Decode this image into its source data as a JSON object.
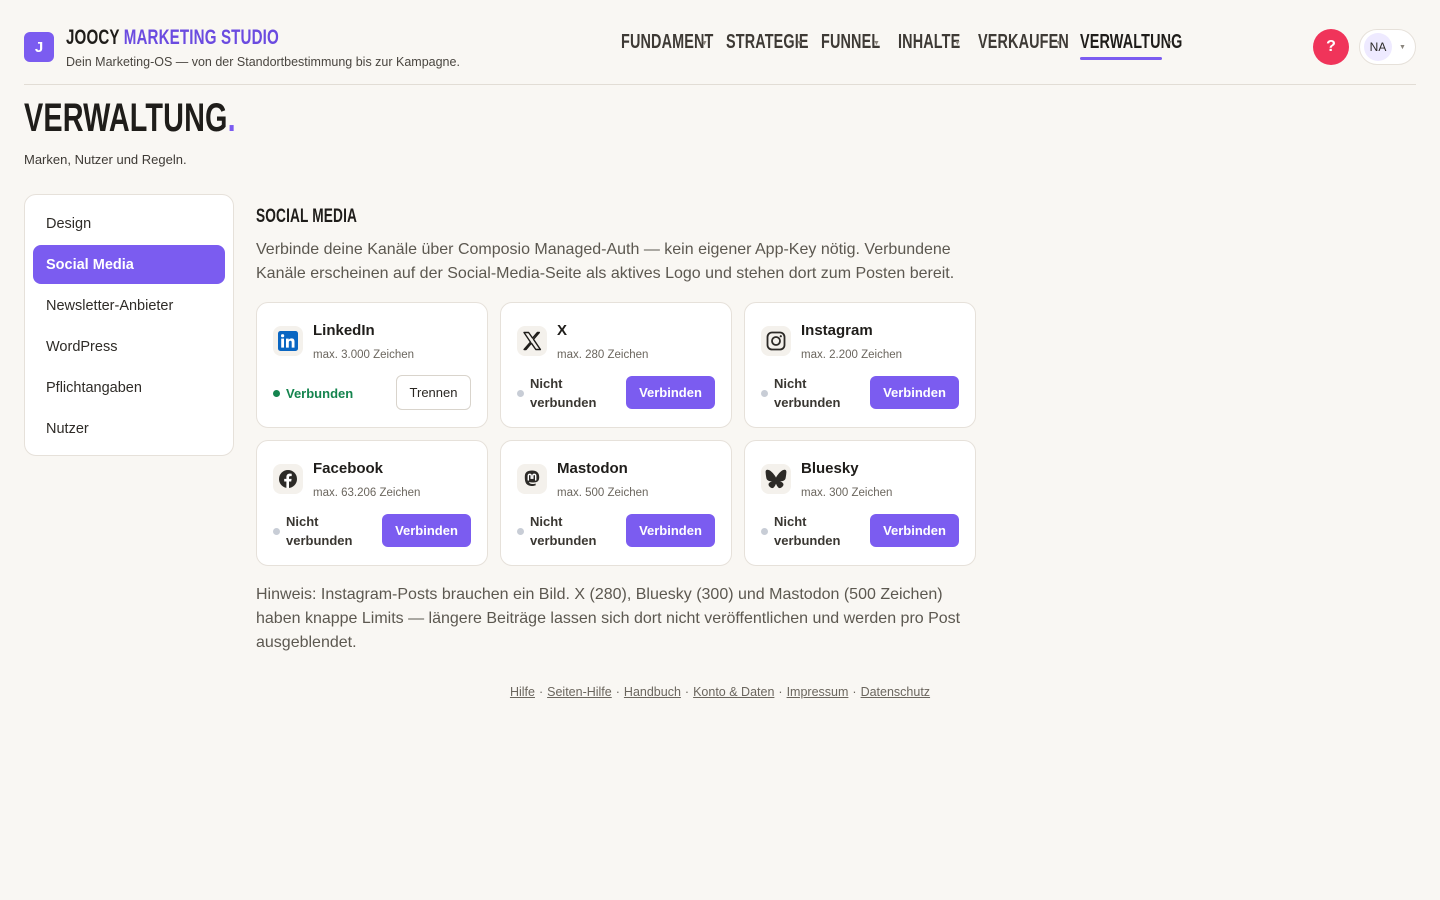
{
  "header": {
    "logo_letter": "J",
    "brand_part1": "JOOCY",
    "brand_part2": "MARKETING STUDIO",
    "tagline": "Dein Marketing-OS — von der Standortbestimmung bis zur Kampagne.",
    "nav": [
      {
        "label": "FUNDAMENT",
        "active": false
      },
      {
        "label": "STRATEGIE",
        "active": false
      },
      {
        "label": "FUNNEL",
        "active": false
      },
      {
        "label": "INHALTE",
        "active": false
      },
      {
        "label": "VERKAUFEN",
        "active": false
      },
      {
        "label": "VERWALTUNG",
        "active": true
      }
    ],
    "help_label": "?",
    "user_initials": "NA"
  },
  "page": {
    "title": "VERWALTUNG",
    "title_dot": ".",
    "subtitle": "Marken, Nutzer und Regeln."
  },
  "sidebar": {
    "items": [
      {
        "label": "Design",
        "active": false
      },
      {
        "label": "Social Media",
        "active": true
      },
      {
        "label": "Newsletter-Anbieter",
        "active": false
      },
      {
        "label": "WordPress",
        "active": false
      },
      {
        "label": "Pflichtangaben",
        "active": false
      },
      {
        "label": "Nutzer",
        "active": false
      }
    ]
  },
  "social": {
    "title": "SOCIAL MEDIA",
    "intro": "Verbinde deine Kanäle über Composio Managed-Auth — kein eigener App-Key nötig. Verbundene Kanäle erscheinen auf der Social-Media-Seite als aktives Logo und stehen dort zum Posten bereit.",
    "cards": [
      {
        "name": "LinkedIn",
        "limit": "max. 3.000 Zeichen",
        "status": "Verbunden",
        "connected": true,
        "button": "Trennen",
        "icon": "linkedin-icon"
      },
      {
        "name": "X",
        "limit": "max. 280 Zeichen",
        "status": "Nicht verbunden",
        "connected": false,
        "button": "Verbinden",
        "icon": "x-icon"
      },
      {
        "name": "Instagram",
        "limit": "max. 2.200 Zeichen",
        "status": "Nicht verbunden",
        "connected": false,
        "button": "Verbinden",
        "icon": "instagram-icon"
      },
      {
        "name": "Facebook",
        "limit": "max. 63.206 Zeichen",
        "status": "Nicht verbunden",
        "connected": false,
        "button": "Verbinden",
        "icon": "facebook-icon"
      },
      {
        "name": "Mastodon",
        "limit": "max. 500 Zeichen",
        "status": "Nicht verbunden",
        "connected": false,
        "button": "Verbinden",
        "icon": "mastodon-icon"
      },
      {
        "name": "Bluesky",
        "limit": "max. 300 Zeichen",
        "status": "Nicht verbunden",
        "connected": false,
        "button": "Verbinden",
        "icon": "bluesky-icon"
      }
    ],
    "note": "Hinweis: Instagram-Posts brauchen ein Bild. X (280), Bluesky (300) und Mastodon (500 Zeichen) haben knappe Limits — längere Beiträge lassen sich dort nicht veröffentlichen und werden pro Post ausgeblendet."
  },
  "footer": {
    "links": [
      "Hilfe",
      "Seiten-Hilfe",
      "Handbuch",
      "Konto & Daten",
      "Impressum",
      "Datenschutz"
    ],
    "separator": "·"
  },
  "colors": {
    "accent": "#7b5cf0",
    "background": "#f9f7f3",
    "connected": "#14844e",
    "help": "#f0345a"
  }
}
